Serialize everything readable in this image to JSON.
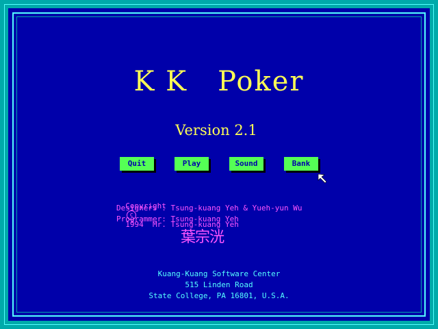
{
  "title": "K K   Poker",
  "version": "Version 2.1",
  "buttons": {
    "quit": "Quit",
    "play": "Play",
    "sound": "Sound",
    "bank": "Bank"
  },
  "credits": {
    "copyright_label": "Copyright",
    "copyright_symbol": "c",
    "copyright_text": "1994  Mr. Tsung-kuang Yeh",
    "designers": "Designers : Tsung-kuang Yeh & Yueh-yun Wu",
    "programmer": "Programmer: Tsung-kuang Yeh",
    "chinese_name": "葉宗洸"
  },
  "address": {
    "company": "Kuang-Kuang Software Center",
    "street": "515 Linden Road",
    "city": "State College, PA 16801, U.S.A."
  },
  "colors": {
    "background": "#0000aa",
    "frame": "#00aaaa",
    "title": "#ffff55",
    "button": "#55ff55",
    "credits": "#ff55ff",
    "address": "#55ffff"
  },
  "icons": {
    "cursor": "mouse-pointer-icon"
  }
}
